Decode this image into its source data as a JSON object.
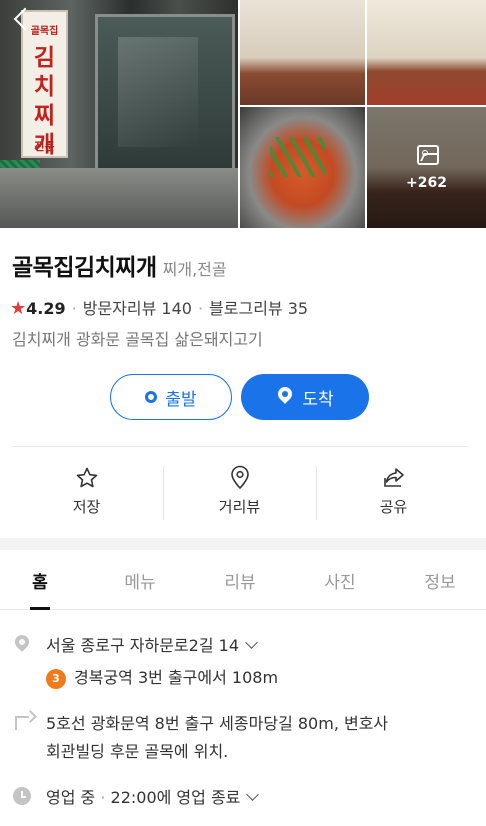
{
  "photos": {
    "main_sign": {
      "top": "골목집",
      "middle": "김치찌개",
      "bottom": "전문"
    },
    "more_count": "+262"
  },
  "place": {
    "name": "골목집김치찌개",
    "category": "찌개,전골",
    "rating": "4.29",
    "visitor_reviews": "방문자리뷰 140",
    "blog_reviews": "블로그리뷰 35",
    "description": "김치찌개 광화문 골목집 삶은돼지고기"
  },
  "buttons": {
    "start": "출발",
    "arrive": "도착"
  },
  "actions": [
    {
      "label": "저장",
      "icon": "star-outline-icon"
    },
    {
      "label": "거리뷰",
      "icon": "location-outline-icon"
    },
    {
      "label": "공유",
      "icon": "share-icon"
    }
  ],
  "tabs": [
    {
      "label": "홈",
      "active": true
    },
    {
      "label": "메뉴"
    },
    {
      "label": "리뷰"
    },
    {
      "label": "사진"
    },
    {
      "label": "정보"
    }
  ],
  "details": {
    "address": "서울 종로구 자하문로2길 14",
    "metro_line": "3",
    "metro_line_color": "#ef7c1c",
    "metro_text": "경복궁역 3번 출구에서 108m",
    "directions_line1": "5호선 광화문역 8번 출구 세종마당길 80m, 변호사",
    "directions_line2": "회관빌딩 후문 골목에 위치.",
    "status": "영업 중",
    "hours": "22:00에 영업 종료"
  },
  "colors": {
    "accent": "#1a73e8",
    "star": "#e23b3b"
  }
}
